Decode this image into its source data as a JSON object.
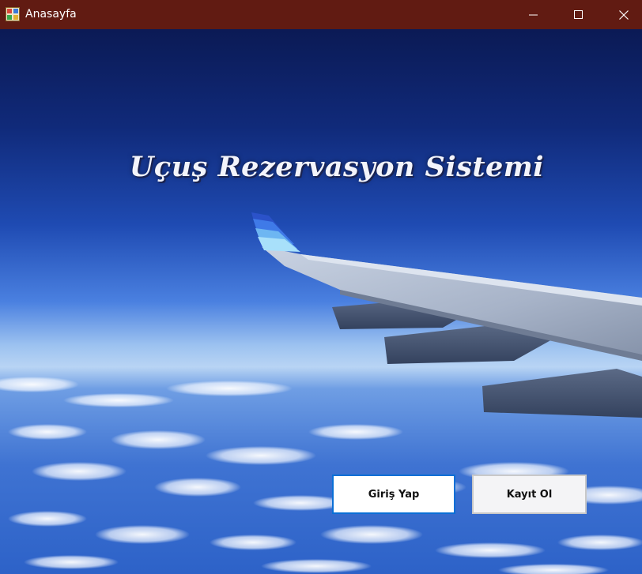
{
  "window": {
    "title": "Anasayfa",
    "titlebar_color": "#611b12"
  },
  "controls": {
    "minimize_icon": "minimize-icon",
    "maximize_icon": "maximize-icon",
    "close_icon": "close-icon"
  },
  "main": {
    "heading": "Uçuş Rezervasyon Sistemi",
    "login_button": "Giriş Yap",
    "register_button": "Kayıt Ol",
    "background": "airplane-wing-over-clouds"
  },
  "colors": {
    "sky_top": "#0b1a55",
    "sky_mid": "#2f5fd0",
    "horizon": "#b6d4f4",
    "accent": "#0a6fd6"
  }
}
